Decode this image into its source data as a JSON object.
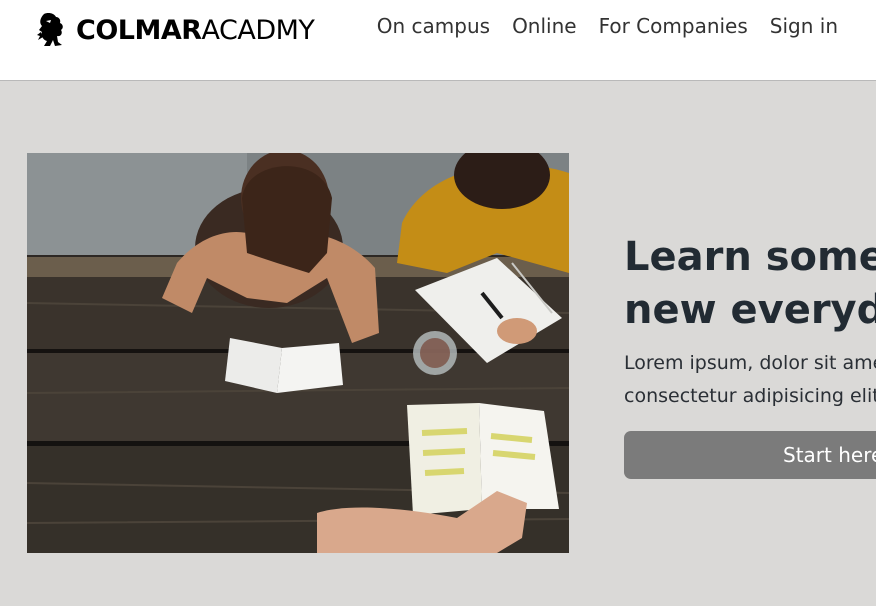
{
  "brand": {
    "name_bold": "COLMAR",
    "name_light": "ACADMY",
    "icon": "lion-icon"
  },
  "nav": {
    "items": [
      {
        "label": "On campus"
      },
      {
        "label": "Online"
      },
      {
        "label": "For Companies"
      },
      {
        "label": "Sign in"
      }
    ]
  },
  "hero": {
    "title_line1": "Learn something",
    "title_line2": "new everyday",
    "subtitle_line1": "Lorem ipsum, dolor sit amet",
    "subtitle_line2": "consectetur adipisicing elit.",
    "cta_label": "Start here",
    "image_alt_icon": "students-reading-photo"
  },
  "colors": {
    "page_bg": "#dad9d7",
    "navbar_bg": "#ffffff",
    "title_text": "#222b33",
    "button_bg": "#7b7b7b",
    "button_text": "#ffffff"
  }
}
